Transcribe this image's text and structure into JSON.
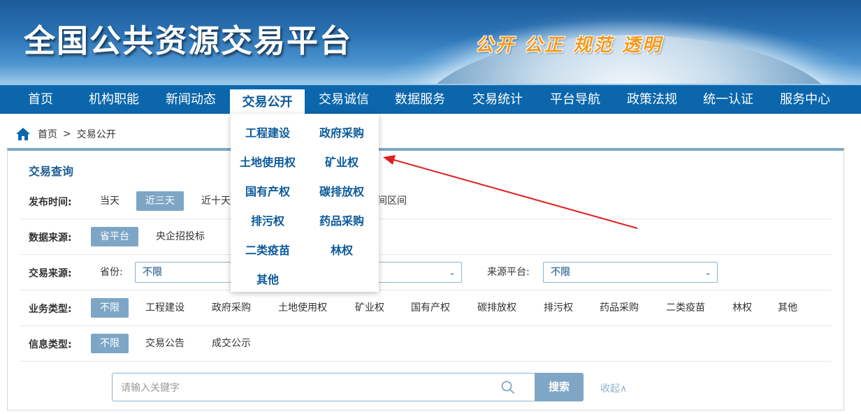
{
  "header": {
    "site_title": "全国公共资源交易平台",
    "slogan": "公开 公正 规范 透明"
  },
  "nav": {
    "items": [
      "首页",
      "机构职能",
      "新闻动态",
      "交易公开",
      "交易诚信",
      "数据服务",
      "交易统计",
      "平台导航",
      "政策法规",
      "统一认证",
      "服务中心"
    ],
    "active": "交易公开"
  },
  "breadcrumb": {
    "home": "首页",
    "separator": ">",
    "current": "交易公开"
  },
  "dropdown": {
    "items": [
      "工程建设",
      "政府采购",
      "土地使用权",
      "矿业权",
      "国有产权",
      "碳排放权",
      "排污权",
      "药品采购",
      "二类疫苗",
      "林权",
      "其他"
    ]
  },
  "query": {
    "title": "交易查询",
    "publish_time": {
      "label": "发布时间:",
      "options": [
        "当天",
        "近三天",
        "近十天"
      ],
      "selected": "近三天",
      "partial_option": "间区间"
    },
    "data_source": {
      "label": "数据来源:",
      "options": [
        "省平台",
        "央企招投标"
      ],
      "selected": "省平台"
    },
    "trade_source": {
      "label": "交易来源:",
      "province_label": "省份:",
      "province_value": "不限",
      "platform_label": "来源平台:",
      "platform_value": "不限"
    },
    "business_type": {
      "label": "业务类型:",
      "options": [
        "不限",
        "工程建设",
        "政府采购",
        "土地使用权",
        "矿业权",
        "国有产权",
        "碳排放权",
        "排污权",
        "药品采购",
        "二类疫苗",
        "林权",
        "其他"
      ],
      "selected": "不限"
    },
    "info_type": {
      "label": "信息类型:",
      "options": [
        "不限",
        "交易公告",
        "成交公示"
      ],
      "selected": "不限"
    },
    "search": {
      "placeholder": "请输入关键字",
      "button": "搜索",
      "collapse": "收起∧"
    }
  },
  "colors": {
    "nav_bg": "#0b66ac",
    "selected_bg": "#7da6c6",
    "link_blue": "#0b5a9b",
    "arrow_red": "#e02020",
    "slogan_orange": "#f39a1e"
  }
}
